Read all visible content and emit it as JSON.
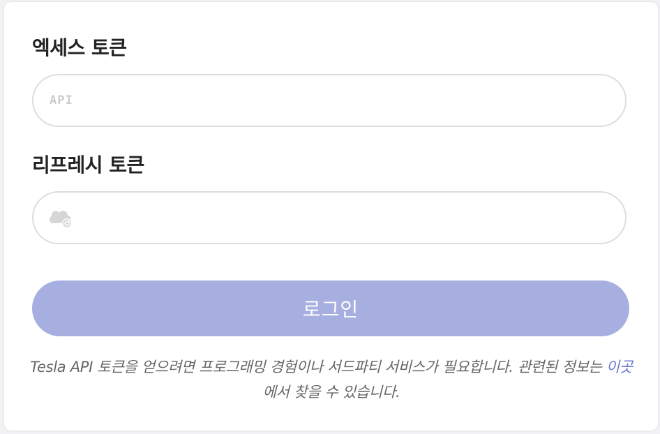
{
  "access_token": {
    "label": "엑세스 토큰",
    "icon": "api-icon",
    "icon_text": "API",
    "value": "",
    "placeholder": ""
  },
  "refresh_token": {
    "label": "리프레시 토큰",
    "icon": "cloud-refresh-icon",
    "value": "",
    "placeholder": ""
  },
  "login_button": {
    "label": "로그인",
    "color": "#a7afe0"
  },
  "note": {
    "text_before": "Tesla API 토큰을 얻으려면 프로그래밍 경험이나 서드파티 서비스가 필요합니다. 관련된 정보는 ",
    "link_text": "이곳",
    "text_after": "에서 찾을 수 있습니다.",
    "link_color": "#6a7ad0"
  }
}
